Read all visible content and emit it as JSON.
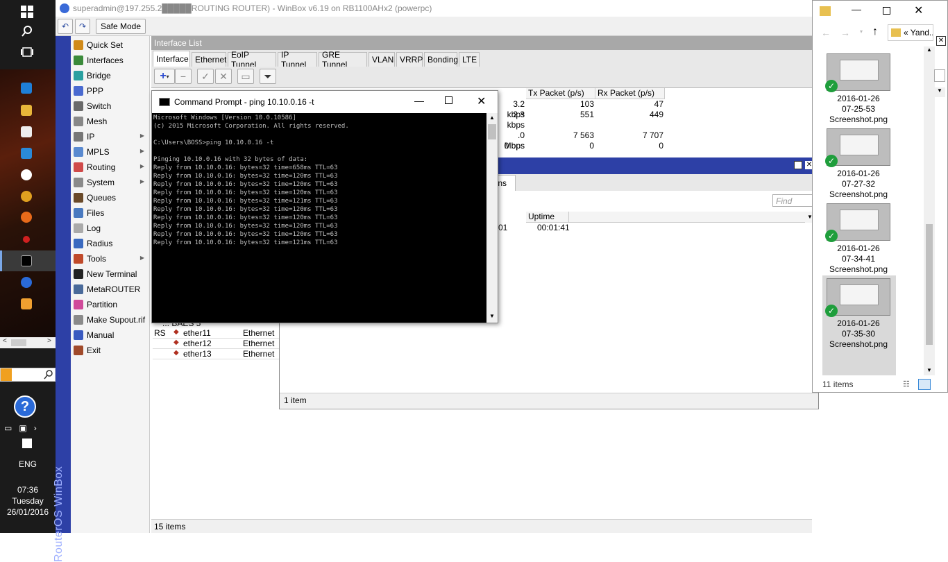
{
  "window": {
    "title": "superadmin@197.255.2█████ROUTING ROUTER) - WinBox v6.19 on RB1100AHx2 (powerpc)",
    "safe_mode": "Safe Mode"
  },
  "taskbar": {
    "lang": "ENG",
    "time": "07:36",
    "day": "Tuesday",
    "date": "26/01/2016",
    "branding": "RouterOS WinBox"
  },
  "menu": [
    {
      "label": "Quick Set",
      "icon": "quickset-icon",
      "color": "#d08a1a",
      "arrow": false
    },
    {
      "label": "Interfaces",
      "icon": "interfaces-icon",
      "color": "#3a8a3a",
      "arrow": false
    },
    {
      "label": "Bridge",
      "icon": "bridge-icon",
      "color": "#2aa0a0",
      "arrow": false
    },
    {
      "label": "PPP",
      "icon": "ppp-icon",
      "color": "#4a6ad0",
      "arrow": false
    },
    {
      "label": "Switch",
      "icon": "switch-icon",
      "color": "#6a6a6a",
      "arrow": false
    },
    {
      "label": "Mesh",
      "icon": "mesh-icon",
      "color": "#888888",
      "arrow": false
    },
    {
      "label": "IP",
      "icon": "ip-icon",
      "color": "#777777",
      "arrow": true
    },
    {
      "label": "MPLS",
      "icon": "mpls-icon",
      "color": "#5a8ad0",
      "arrow": true
    },
    {
      "label": "Routing",
      "icon": "routing-icon",
      "color": "#d04a4a",
      "arrow": true
    },
    {
      "label": "System",
      "icon": "system-icon",
      "color": "#8a8a8a",
      "arrow": true
    },
    {
      "label": "Queues",
      "icon": "queues-icon",
      "color": "#6a4a2a",
      "arrow": false
    },
    {
      "label": "Files",
      "icon": "files-icon",
      "color": "#4a7ac0",
      "arrow": false
    },
    {
      "label": "Log",
      "icon": "log-icon",
      "color": "#aaaaaa",
      "arrow": false
    },
    {
      "label": "Radius",
      "icon": "radius-icon",
      "color": "#3a6ac0",
      "arrow": false
    },
    {
      "label": "Tools",
      "icon": "tools-icon",
      "color": "#c04a2a",
      "arrow": true
    },
    {
      "label": "New Terminal",
      "icon": "terminal-icon",
      "color": "#222222",
      "arrow": false
    },
    {
      "label": "MetaROUTER",
      "icon": "metarouter-icon",
      "color": "#4a6a9a",
      "arrow": false
    },
    {
      "label": "Partition",
      "icon": "partition-icon",
      "color": "#d04a9a",
      "arrow": false
    },
    {
      "label": "Make Supout.rif",
      "icon": "supout-icon",
      "color": "#8a8a8a",
      "arrow": false
    },
    {
      "label": "Manual",
      "icon": "manual-icon",
      "color": "#3a5ac0",
      "arrow": false
    },
    {
      "label": "Exit",
      "icon": "exit-icon",
      "color": "#a04a2a",
      "arrow": false
    }
  ],
  "interface_list": {
    "title": "Interface List",
    "tabs": [
      "Interface",
      "Ethernet",
      "EoIP Tunnel",
      "IP Tunnel",
      "GRE Tunnel",
      "VLAN",
      "VRRP",
      "Bonding",
      "LTE"
    ],
    "headers": {
      "tx": "Tx Packet (p/s)",
      "rx": "Rx Packet (p/s)"
    },
    "stat_rows": [
      {
        "rate": "3.2 kbps",
        "tx": "103",
        "rx": "47"
      },
      {
        "rate": "2.3 kbps",
        "tx": "551",
        "rx": "449"
      },
      {
        "rate": ".0 Mbps",
        "tx": "7 563",
        "rx": "7 707"
      },
      {
        "rate": "0 bps",
        "tx": "0",
        "rx": "0"
      }
    ],
    "comment_row": "... BAES 5",
    "rows": [
      {
        "flag": "RS",
        "name": "ether11",
        "type": "Ethernet"
      },
      {
        "flag": "",
        "name": "ether12",
        "type": "Ethernet"
      },
      {
        "flag": "",
        "name": "ether13",
        "type": "Ethernet"
      }
    ],
    "status": "15 items"
  },
  "second_window": {
    "tab_partial": "ions",
    "find_placeholder": "Find",
    "uptime_header": "Uptime",
    "cell_partial": "01",
    "uptime_value": "00:01:41",
    "status": "1 item"
  },
  "cmd": {
    "title": "Command Prompt - ping  10.10.0.16 -t",
    "lines": [
      "Microsoft Windows [Version 10.0.10586]",
      "(c) 2015 Microsoft Corporation. All rights reserved.",
      "",
      "C:\\Users\\BOSS>ping 10.10.0.16 -t",
      "",
      "Pinging 10.10.0.16 with 32 bytes of data:",
      "Reply from 10.10.0.16: bytes=32 time=658ms TTL=63",
      "Reply from 10.10.0.16: bytes=32 time=120ms TTL=63",
      "Reply from 10.10.0.16: bytes=32 time=120ms TTL=63",
      "Reply from 10.10.0.16: bytes=32 time=120ms TTL=63",
      "Reply from 10.10.0.16: bytes=32 time=121ms TTL=63",
      "Reply from 10.10.0.16: bytes=32 time=120ms TTL=63",
      "Reply from 10.10.0.16: bytes=32 time=120ms TTL=63",
      "Reply from 10.10.0.16: bytes=32 time=120ms TTL=63",
      "Reply from 10.10.0.16: bytes=32 time=120ms TTL=63",
      "Reply from 10.10.0.16: bytes=32 time=121ms TTL=63"
    ]
  },
  "explorer": {
    "breadcrumb": "« Yand..",
    "files": [
      {
        "date": "2016-01-26",
        "time": "07-25-53",
        "name": "Screenshot.png"
      },
      {
        "date": "2016-01-26",
        "time": "07-27-32",
        "name": "Screenshot.png"
      },
      {
        "date": "2016-01-26",
        "time": "07-34-41",
        "name": "Screenshot.png"
      },
      {
        "date": "2016-01-26",
        "time": "07-35-30",
        "name": "Screenshot.png"
      }
    ],
    "count": "11 items"
  }
}
